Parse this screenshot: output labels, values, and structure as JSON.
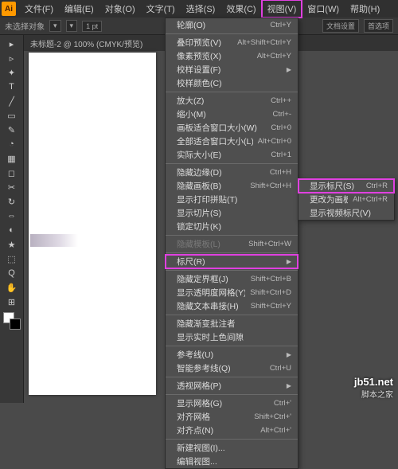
{
  "app_icon": "Ai",
  "menubar": [
    "文件(F)",
    "编辑(E)",
    "对象(O)",
    "文字(T)",
    "选择(S)",
    "效果(C)",
    "视图(V)",
    "窗口(W)",
    "帮助(H)"
  ],
  "menubar_highlight_index": 6,
  "ctrlbar": {
    "noselect": "未选择对象",
    "stroke_label": "1 pt",
    "doc_setup": "文档设置",
    "prefs": "首选项"
  },
  "doc_tab": "未标题-2 @ 100% (CMYK/预览)",
  "tools": [
    "▸",
    "▹",
    "✦",
    "T",
    "╱",
    "▭",
    "✎",
    "◔",
    "▦",
    "◻",
    "✂",
    "↻",
    "⇔",
    "◐",
    "★",
    "⬚",
    "Q",
    "✋",
    "⊞"
  ],
  "dropdown": {
    "items": [
      {
        "label": "轮廓(O)",
        "shortcut": "Ctrl+Y"
      },
      {
        "sep": true
      },
      {
        "label": "叠印预览(V)",
        "shortcut": "Alt+Shift+Ctrl+Y"
      },
      {
        "label": "像素预览(X)",
        "shortcut": "Alt+Ctrl+Y"
      },
      {
        "label": "校样设置(F)",
        "submenu": true
      },
      {
        "label": "校样颜色(C)"
      },
      {
        "sep": true
      },
      {
        "label": "放大(Z)",
        "shortcut": "Ctrl++"
      },
      {
        "label": "缩小(M)",
        "shortcut": "Ctrl+-"
      },
      {
        "label": "画板适合窗口大小(W)",
        "shortcut": "Ctrl+0"
      },
      {
        "label": "全部适合窗口大小(L)",
        "shortcut": "Alt+Ctrl+0"
      },
      {
        "label": "实际大小(E)",
        "shortcut": "Ctrl+1"
      },
      {
        "sep": true
      },
      {
        "label": "隐藏边缘(D)",
        "shortcut": "Ctrl+H"
      },
      {
        "label": "隐藏画板(B)",
        "shortcut": "Shift+Ctrl+H"
      },
      {
        "label": "显示打印拼贴(T)"
      },
      {
        "label": "显示切片(S)"
      },
      {
        "label": "锁定切片(K)"
      },
      {
        "sep": true
      },
      {
        "label": "隐藏模板(L)",
        "shortcut": "Shift+Ctrl+W",
        "disabled": true
      },
      {
        "sep": true
      },
      {
        "label": "标尺(R)",
        "submenu": true,
        "highlight": true
      },
      {
        "sep": true
      },
      {
        "label": "隐藏定界框(J)",
        "shortcut": "Shift+Ctrl+B"
      },
      {
        "label": "显示透明度网格(Y)",
        "shortcut": "Shift+Ctrl+D"
      },
      {
        "label": "隐藏文本串接(H)",
        "shortcut": "Shift+Ctrl+Y"
      },
      {
        "sep": true
      },
      {
        "label": "隐藏渐变批注者"
      },
      {
        "label": "显示实时上色间隙"
      },
      {
        "sep": true
      },
      {
        "label": "参考线(U)",
        "submenu": true
      },
      {
        "label": "智能参考线(Q)",
        "shortcut": "Ctrl+U"
      },
      {
        "sep": true
      },
      {
        "label": "透视网格(P)",
        "submenu": true
      },
      {
        "sep": true
      },
      {
        "label": "显示网格(G)",
        "shortcut": "Ctrl+'"
      },
      {
        "label": "对齐网格",
        "shortcut": "Shift+Ctrl+'"
      },
      {
        "label": "对齐点(N)",
        "shortcut": "Alt+Ctrl+'"
      },
      {
        "sep": true
      },
      {
        "label": "新建视图(I)..."
      },
      {
        "label": "编辑视图..."
      }
    ]
  },
  "submenu": {
    "items": [
      {
        "label": "显示标尺(S)",
        "shortcut": "Ctrl+R",
        "highlight": true
      },
      {
        "label": "更改为画板标尺(C)",
        "shortcut": "Alt+Ctrl+R"
      },
      {
        "label": "显示视频标尺(V)"
      }
    ]
  },
  "watermark": {
    "main": "jb51.net",
    "sub": "脚本之家"
  }
}
